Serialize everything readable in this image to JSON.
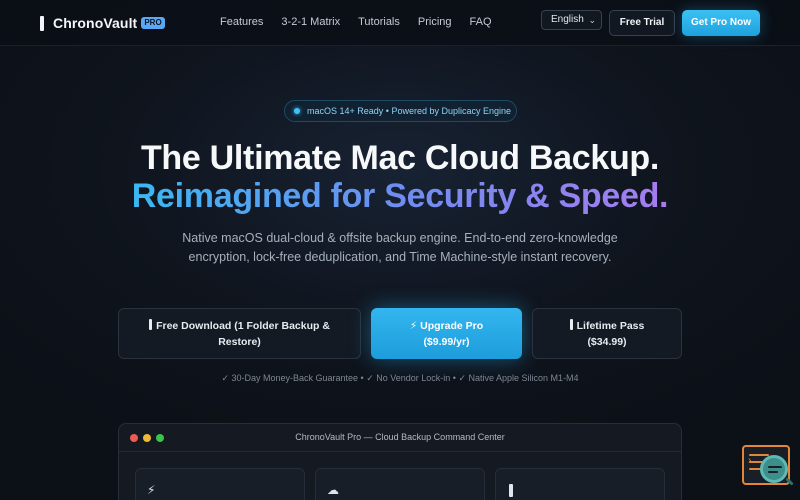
{
  "nav": {
    "brand": "ChronoVault",
    "badge": "PRO",
    "links": [
      "Features",
      "3-2-1 Matrix",
      "Tutorials",
      "Pricing",
      "FAQ"
    ],
    "language": "English",
    "trial_label": "Free Trial",
    "pro_label": "Get Pro Now"
  },
  "hero": {
    "pill": "macOS 14+ Ready • Powered by Duplicacy Engine",
    "headline": "The Ultimate Mac Cloud Backup.",
    "headline_accent": "Reimagined for Security & Speed.",
    "subtitle": "Native macOS dual-cloud & offsite backup engine. End-to-end zero-knowledge encryption, lock-free deduplication, and Time Machine-style instant recovery."
  },
  "cta": {
    "free_line1": "Free Download (1 Folder Backup &",
    "free_line2": "Restore)",
    "upgrade_line1": "⚡ Upgrade Pro",
    "upgrade_line2": "($9.99/yr)",
    "lifetime_line1": "Lifetime Pass",
    "lifetime_line2": "($34.99)"
  },
  "guarantees": "✓ 30-Day Money-Back Guarantee • ✓ No Vendor Lock-in • ✓ Native Apple Silicon M1-M4",
  "window": {
    "title": "ChronoVault Pro — Cloud Backup Command Center",
    "cards": [
      {
        "icon": "lightning-icon",
        "glyph": "⚡"
      },
      {
        "icon": "cloud-icon",
        "glyph": "☁"
      },
      {
        "icon": "bar-icon",
        "glyph": ""
      }
    ]
  },
  "colors": {
    "accent": "#2aaee8",
    "background": "#0f141d",
    "gradient_start": "#3ab8f3",
    "gradient_end": "#a67cf0"
  }
}
